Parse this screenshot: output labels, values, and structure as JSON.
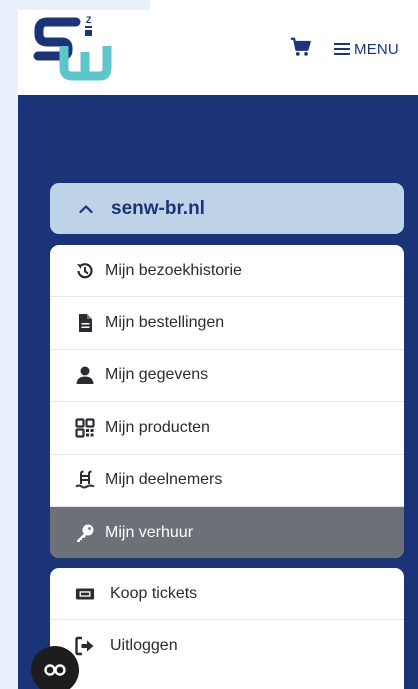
{
  "header": {
    "menu_label": "MENU",
    "logo_letters": {
      "s": "S",
      "en": "EN",
      "w": "W"
    },
    "logo_colors": {
      "navy": "#1b3478",
      "teal": "#5ec6cb"
    }
  },
  "account": {
    "domain": "senw-br.nl",
    "chevron": "chevron-up-icon"
  },
  "menu": {
    "items": [
      {
        "label": "Mijn bezoekhistorie",
        "icon": "history-icon",
        "active": false
      },
      {
        "label": "Mijn bestellingen",
        "icon": "document-icon",
        "active": false
      },
      {
        "label": "Mijn gegevens",
        "icon": "user-icon",
        "active": false
      },
      {
        "label": "Mijn producten",
        "icon": "qr-code-icon",
        "active": false
      },
      {
        "label": "Mijn deelnemers",
        "icon": "swimming-pool-icon",
        "active": false
      },
      {
        "label": "Mijn verhuur",
        "icon": "key-icon",
        "active": true
      }
    ],
    "secondary": [
      {
        "label": "Koop tickets",
        "icon": "ticket-icon"
      },
      {
        "label": "Uitloggen",
        "icon": "logout-icon"
      }
    ]
  },
  "colors": {
    "brand_navy": "#1b3478",
    "domain_bg": "#bfd3e8",
    "active_bg": "#6c7077"
  }
}
